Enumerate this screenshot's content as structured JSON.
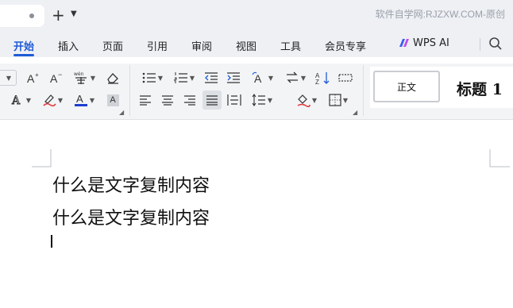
{
  "watermark": "软件自学网:RJZXW.COM-原创",
  "menu": {
    "tabs": [
      "开始",
      "插入",
      "页面",
      "引用",
      "审阅",
      "视图",
      "工具",
      "会员专享"
    ],
    "ai_label": "WPS AI"
  },
  "ribbon": {
    "clear_glyph": "A",
    "text_color": "#1f3fd0",
    "highlight_color": "#e03c3c",
    "styles": {
      "normal": "正文",
      "heading1": "标题 1"
    }
  },
  "document": {
    "lines": [
      "什么是文字复制内容",
      "什么是文字复制内容"
    ]
  }
}
